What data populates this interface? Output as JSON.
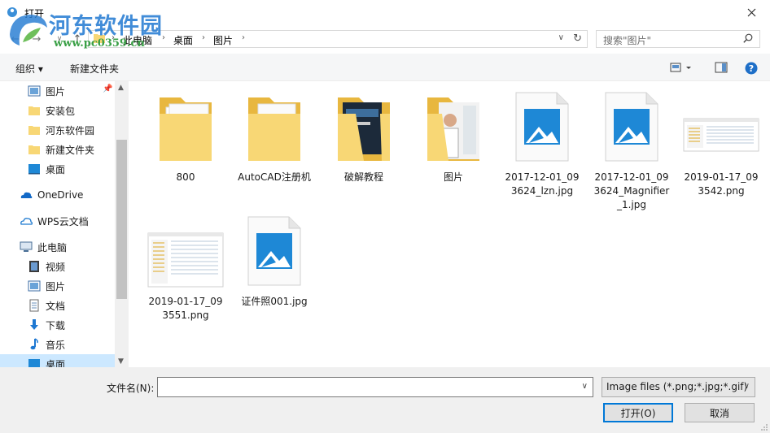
{
  "window": {
    "title": "打开"
  },
  "watermark": {
    "site": "河东软件园",
    "url": "www.pc0359.cn"
  },
  "address": {
    "crumbs": [
      "此电脑",
      "桌面",
      "图片"
    ]
  },
  "search": {
    "placeholder": "搜索\"图片\""
  },
  "toolbar": {
    "organize": "组织 ▾",
    "new_folder": "新建文件夹"
  },
  "sidebar": {
    "items": [
      {
        "label": "图片",
        "icon": "pictures-icon"
      },
      {
        "label": "安装包",
        "icon": "folder-icon"
      },
      {
        "label": "河东软件园",
        "icon": "folder-icon"
      },
      {
        "label": "新建文件夹",
        "icon": "folder-icon"
      },
      {
        "label": "桌面",
        "icon": "desktop-icon"
      },
      {
        "label": "OneDrive",
        "icon": "onedrive-icon"
      },
      {
        "label": "WPS云文档",
        "icon": "wps-cloud-icon"
      },
      {
        "label": "此电脑",
        "icon": "this-pc-icon"
      },
      {
        "label": "视频",
        "icon": "videos-icon"
      },
      {
        "label": "图片",
        "icon": "pictures-icon"
      },
      {
        "label": "文档",
        "icon": "documents-icon"
      },
      {
        "label": "下载",
        "icon": "downloads-icon"
      },
      {
        "label": "音乐",
        "icon": "music-icon"
      },
      {
        "label": "桌面",
        "icon": "desktop-icon"
      }
    ]
  },
  "files": [
    {
      "name": "800",
      "type": "folder"
    },
    {
      "name": "AutoCAD注册机",
      "type": "folder"
    },
    {
      "name": "破解教程",
      "type": "folder"
    },
    {
      "name": "图片",
      "type": "folder"
    },
    {
      "name": "2017-12-01_093624_lzn.jpg",
      "type": "image"
    },
    {
      "name": "2017-12-01_093624_Magnifier_1.jpg",
      "type": "image"
    },
    {
      "name": "2019-01-17_093542.png",
      "type": "screenshot"
    },
    {
      "name": "2019-01-17_093551.png",
      "type": "screenshot"
    },
    {
      "name": "证件照001.jpg",
      "type": "image"
    }
  ],
  "bottom": {
    "filename_label": "文件名(N):",
    "filename_value": "",
    "filetype": "Image files (*.png;*.jpg;*.gif)",
    "open_label": "打开(O)",
    "cancel_label": "取消"
  },
  "colors": {
    "accent": "#0078d7",
    "folder": "#f8d775",
    "selected": "#cce8ff"
  }
}
